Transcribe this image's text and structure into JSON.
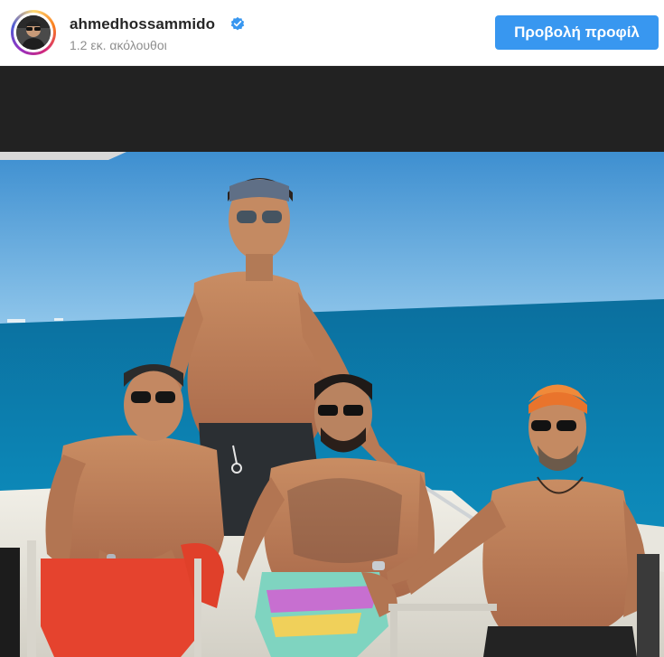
{
  "post": {
    "username": "ahmedhossammido",
    "verified": true,
    "followers": "1.2 εκ. ακόλουθοι",
    "view_profile_label": "Προβολή προφίλ"
  },
  "colors": {
    "button": "#3897f0",
    "verified_badge": "#3897f0",
    "username": "#262626",
    "secondary_text": "#8e8e8e",
    "dark_bar": "#222222",
    "sky": "#4fa3d8",
    "sea": "#0d7fae"
  },
  "icons": {
    "verified": "verified-badge-icon",
    "avatar": "profile-avatar"
  },
  "photo": {
    "subject": "four shirtless men seated on a boat with the sea behind them"
  }
}
